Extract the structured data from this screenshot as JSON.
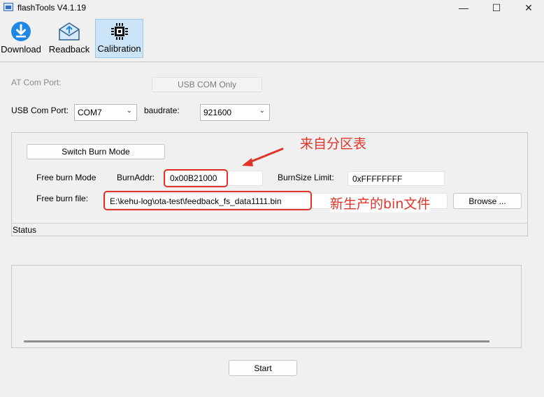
{
  "window": {
    "title": "flashTools V4.1.19",
    "minimize": "—",
    "maximize": "☐",
    "close": "✕"
  },
  "toolbar": {
    "download": "Download",
    "readback": "Readback",
    "calibration": "Calibration"
  },
  "form": {
    "at_com_port_label": "AT Com Port:",
    "usb_com_only": "USB COM Only",
    "usb_com_port_label": "USB Com Port:",
    "usb_com_port_value": "COM7",
    "baudrate_label": "baudrate:",
    "baudrate_value": "921600"
  },
  "burn": {
    "switch_button": "Switch Burn Mode",
    "free_burn_mode_label": "Free burn Mode",
    "burn_addr_label": "BurnAddr:",
    "burn_addr_value": "0x00B21000",
    "burn_size_limit_label": "BurnSize Limit:",
    "burn_size_limit_value": "0xFFFFFFFF",
    "free_burn_file_label": "Free burn file:",
    "free_burn_file_value": "E:\\kehu-log\\ota-test\\feedback_fs_data1111.bin",
    "browse_button": "Browse ...",
    "status_label": "Status"
  },
  "annotations": {
    "addr_note": "来自分区表",
    "file_note": "新生产的bin文件",
    "color": "#e0342a"
  },
  "start_button": "Start",
  "icons": {
    "download": "download-icon",
    "readback": "readback-icon",
    "calibration": "chip-icon",
    "dropdown": "chevron-down-icon"
  }
}
